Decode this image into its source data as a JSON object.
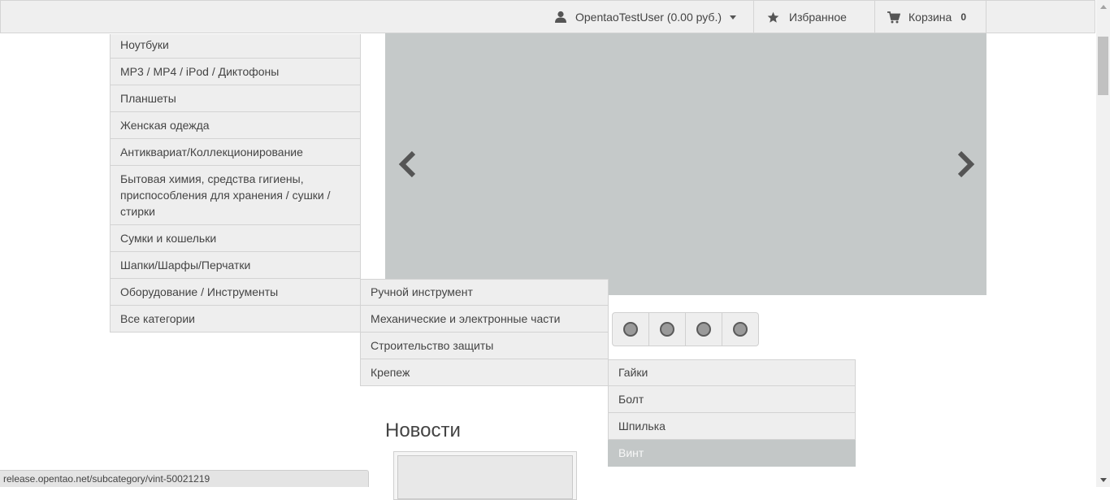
{
  "header": {
    "user_label": "OpentaoTestUser (0.00 руб.)",
    "favorites_label": "Избранное",
    "cart_label": "Корзина",
    "cart_count": "0"
  },
  "categories": [
    "Ноутбуки",
    "MP3 / MP4 / iPod / Диктофоны",
    "Планшеты",
    "Женская одежда",
    "Антиквариат/Коллекционирование",
    "Бытовая химия, средства гигиены, приспособления для хранения / сушки / стирки",
    "Сумки и кошельки",
    "Шапки/Шарфы/Перчатки",
    "Оборудование / Инструменты",
    "Все категории"
  ],
  "subcategories": [
    "Ручной инструмент",
    "Механические и электронные части",
    "Строительство защиты",
    "Крепеж"
  ],
  "subsubcategories": [
    "Гайки",
    "Болт",
    "Шпилька",
    "Винт"
  ],
  "news": {
    "title": "Новости"
  },
  "status_bar": {
    "url": "release.opentao.net/subcategory/vint-50021219"
  }
}
